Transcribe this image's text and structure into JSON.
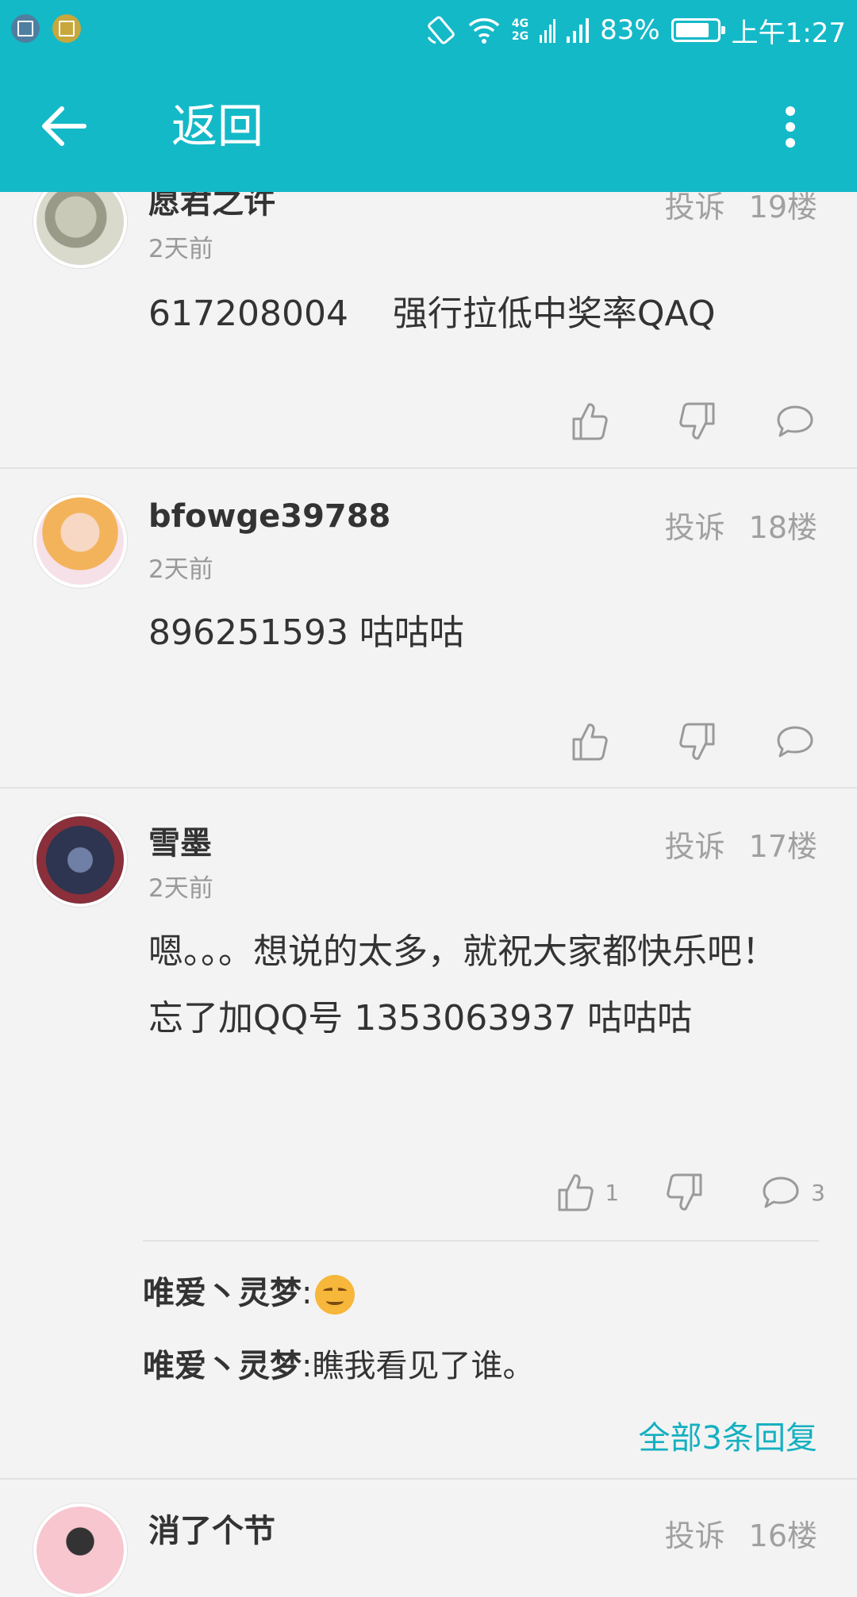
{
  "status_bar": {
    "signal_label": "4G\n2G",
    "battery_percent": "83%",
    "battery_level": 0.83,
    "time": "上午1:27"
  },
  "app_bar": {
    "back_icon": "arrow-left-icon",
    "title": "返回",
    "menu_icon": "more-vert-icon"
  },
  "comments": [
    {
      "username": "愿君之许",
      "time_ago": "2天前",
      "report": "投诉",
      "floor": "19楼",
      "text": "617208004    强行拉低中奖率QAQ",
      "likes": "",
      "comments": ""
    },
    {
      "username": "bfowge39788",
      "time_ago": "2天前",
      "report": "投诉",
      "floor": "18楼",
      "text": "896251593 咕咕咕",
      "likes": "",
      "comments": ""
    },
    {
      "username": "雪墨",
      "time_ago": "2天前",
      "report": "投诉",
      "floor": "17楼",
      "text": "嗯。。。想说的太多，就祝大家都快乐吧！\n忘了加QQ号 1353063937 咕咕咕",
      "likes": "1",
      "comments": "3",
      "replies": [
        {
          "user": "唯爱丶灵梦",
          "sep": ":",
          "text": "",
          "emoji": "smiling-face-emoji"
        },
        {
          "user": "唯爱丶灵梦",
          "sep": ":",
          "text": "瞧我看见了谁。"
        }
      ],
      "all_replies_label": "全部3条回复"
    },
    {
      "username": "消了个节",
      "time_ago": "",
      "report": "投诉",
      "floor": "16楼"
    }
  ],
  "colors": {
    "accent": "#14b9c8",
    "link": "#14b0c0",
    "background": "#f3f3f3"
  }
}
